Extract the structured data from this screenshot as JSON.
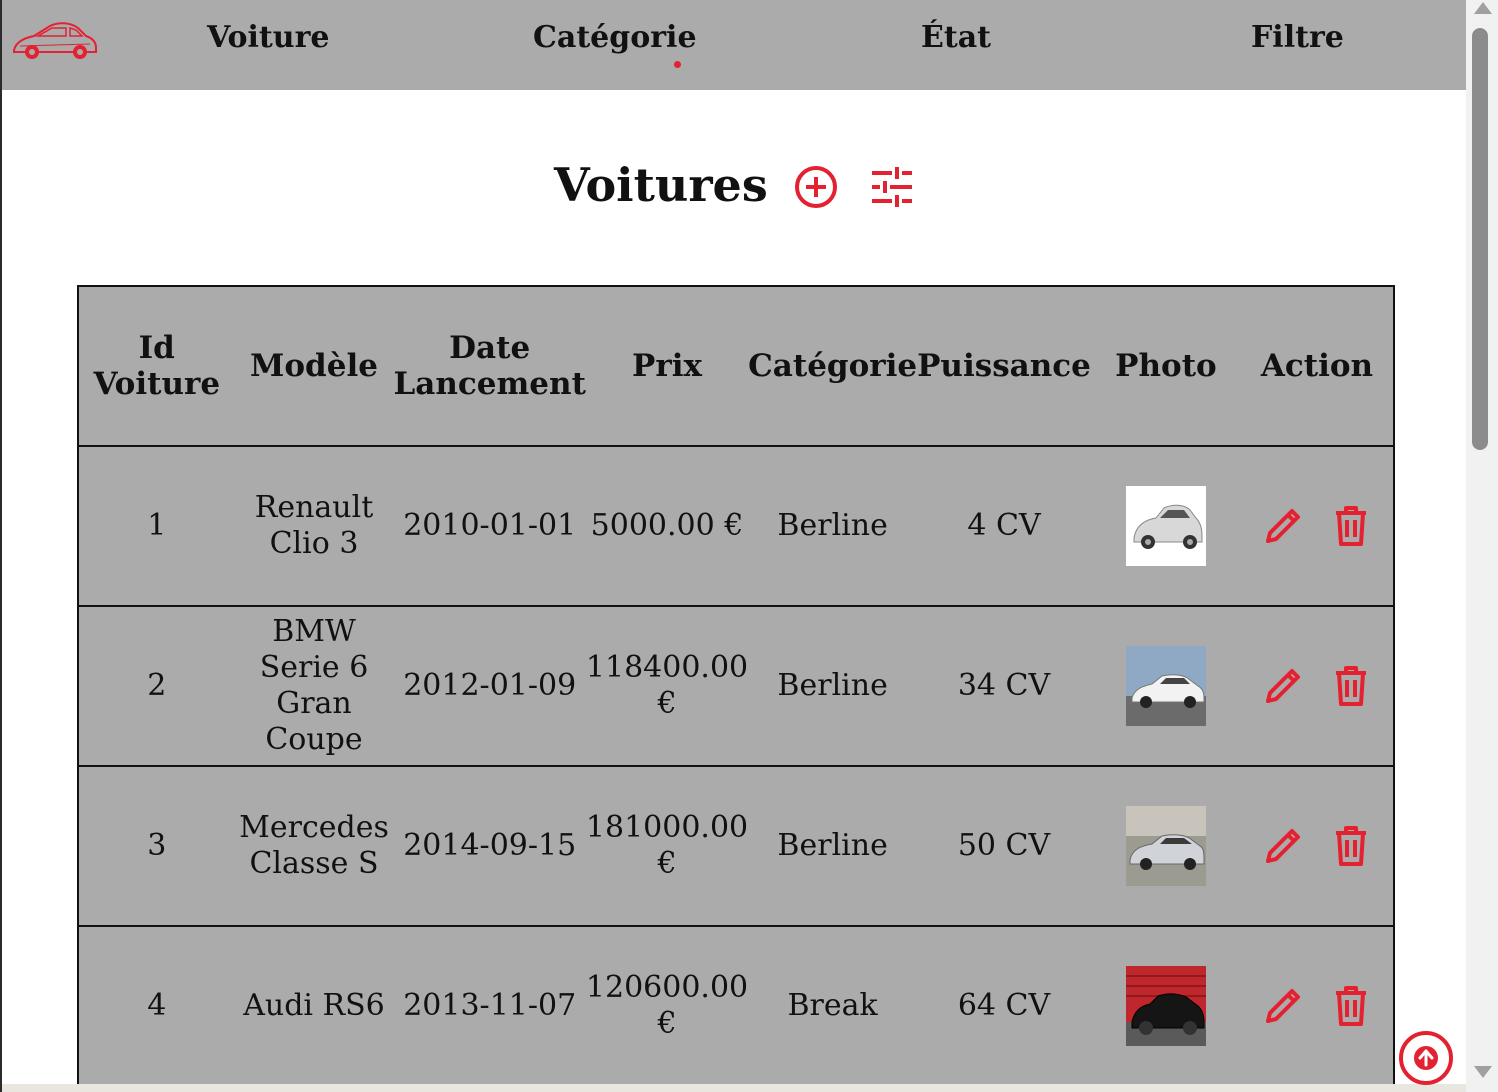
{
  "colors": {
    "accent": "#e32131",
    "navbar_bg": "#ababab",
    "table_bg": "#ababab"
  },
  "navbar": {
    "logo_icon": "car-logo-icon",
    "items": [
      {
        "label": "Voiture"
      },
      {
        "label": "Catégorie",
        "active": true
      },
      {
        "label": "État"
      },
      {
        "label": "Filtre"
      }
    ]
  },
  "page": {
    "title": "Voitures",
    "add_icon": "plus-circle-icon",
    "filter_icon": "sliders-icon"
  },
  "table": {
    "headers": {
      "id": [
        "Id",
        "Voiture"
      ],
      "model": "Modèle",
      "date": [
        "Date",
        "Lancement"
      ],
      "price": "Prix",
      "category": "Catégorie",
      "power": "Puissance",
      "photo": "Photo",
      "action": "Action"
    },
    "rows": [
      {
        "id": "1",
        "model": "Renault Clio 3",
        "date": "2010-01-01",
        "price": "5000.00 €",
        "category": "Berline",
        "power": "4 CV",
        "photo": "white-hatchback"
      },
      {
        "id": "2",
        "model": "BMW Serie 6 Gran Coupe",
        "date": "2012-01-09",
        "price": "118400.00 €",
        "category": "Berline",
        "power": "34 CV",
        "photo": "white-sedan"
      },
      {
        "id": "3",
        "model": "Mercedes Classe S",
        "date": "2014-09-15",
        "price": "181000.00 €",
        "category": "Berline",
        "power": "50 CV",
        "photo": "silver-sedan"
      },
      {
        "id": "4",
        "model": "Audi RS6",
        "date": "2013-11-07",
        "price": "120600.00 €",
        "category": "Break",
        "power": "64 CV",
        "photo": "black-wagon"
      }
    ]
  },
  "back_to_top_icon": "arrow-up-circle-icon"
}
